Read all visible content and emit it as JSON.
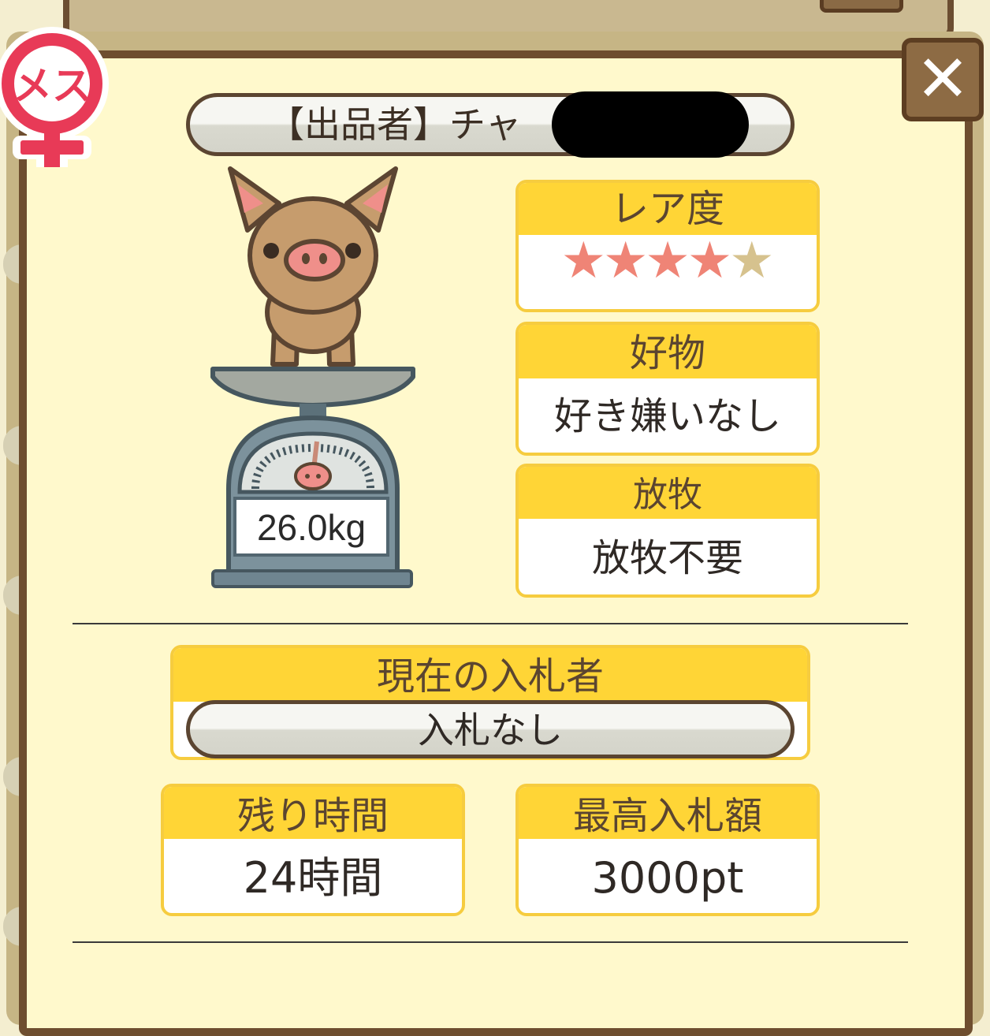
{
  "badge": {
    "label": "メス"
  },
  "close": {
    "label": "✕"
  },
  "seller": {
    "label": "【出品者】チャ"
  },
  "rarity": {
    "title": "レア度",
    "filled": 4,
    "max": 5,
    "filled_color": "#ef8476",
    "empty_color": "#d6c28e"
  },
  "favorite": {
    "title": "好物",
    "value": "好き嫌いなし"
  },
  "grazing": {
    "title": "放牧",
    "value": "放牧不要"
  },
  "weight": {
    "value": "26.0kg"
  },
  "bidder": {
    "title": "現在の入札者",
    "value": "入札なし"
  },
  "remaining": {
    "title": "残り時間",
    "value": "24時間"
  },
  "top_bid": {
    "title": "最高入札額",
    "value": "3000pt"
  },
  "colors": {
    "accent": "#ffd536",
    "frame": "#6e4e2f",
    "panel": "#fff9cc"
  }
}
